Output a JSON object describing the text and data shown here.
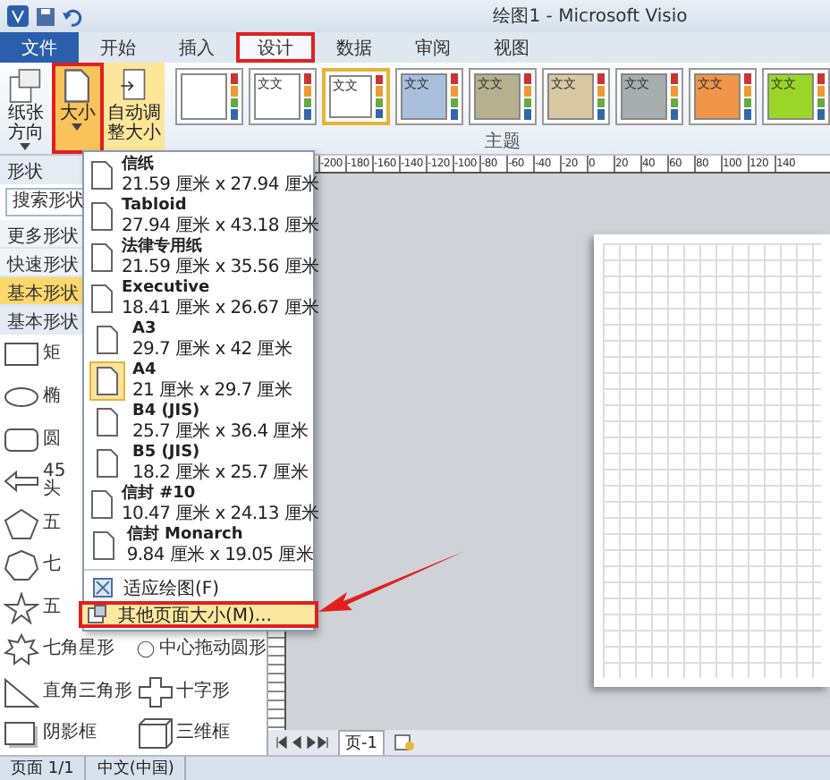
{
  "window": {
    "title": "绘图1 - Microsoft Visio"
  },
  "tabs": [
    {
      "label": "文件",
      "kind": "file",
      "selected": false,
      "annotated": false
    },
    {
      "label": "开始",
      "kind": "tab",
      "selected": false,
      "annotated": false
    },
    {
      "label": "插入",
      "kind": "tab",
      "selected": false,
      "annotated": false
    },
    {
      "label": "设计",
      "kind": "tab",
      "selected": true,
      "annotated": true
    },
    {
      "label": "数据",
      "kind": "tab",
      "selected": false,
      "annotated": false
    },
    {
      "label": "审阅",
      "kind": "tab",
      "selected": false,
      "annotated": false
    },
    {
      "label": "视图",
      "kind": "tab",
      "selected": false,
      "annotated": false
    }
  ],
  "page_setup": [
    {
      "label": "纸张方向",
      "kind": "orientation",
      "expanded": false,
      "highlighted": false,
      "annotated": false
    },
    {
      "label": "大小",
      "kind": "size",
      "expanded": true,
      "highlighted": false,
      "annotated": true
    },
    {
      "label": "自动调整大小",
      "kind": "autosize",
      "expanded": false,
      "highlighted": true,
      "annotated": false
    }
  ],
  "themes": {
    "label": "主题",
    "items": [
      {
        "color": "#ffffff",
        "selected": false
      },
      {
        "color": "#ffffff",
        "sample": "文文",
        "selected": false
      },
      {
        "color": "#ffffff",
        "sample": "文文",
        "selected": true
      },
      {
        "color": "#a9bfdc",
        "sample": "文文",
        "selected": false
      },
      {
        "color": "#b5b08e",
        "sample": "文文",
        "selected": false
      },
      {
        "color": "#d9c9a3",
        "sample": "文文",
        "selected": false
      },
      {
        "color": "#a8aeae",
        "sample": "文文",
        "selected": false
      },
      {
        "color": "#f0954a",
        "sample": "文文",
        "selected": false
      },
      {
        "color": "#9ad628",
        "sample": "文文",
        "selected": false
      }
    ]
  },
  "shapes_panel": {
    "title": "形状",
    "search": {
      "placeholder": "搜索形状"
    },
    "links": [
      {
        "label": "更多形状",
        "selected": false
      },
      {
        "label": "快速形状",
        "selected": false
      },
      {
        "label": "基本形状",
        "selected": true
      }
    ],
    "stencil_title": "基本形状",
    "shapes": [
      [
        {
          "kind": "rectangle",
          "label": "矩"
        }
      ],
      [
        {
          "kind": "ellipse",
          "label": "椭"
        }
      ],
      [
        {
          "kind": "rounded",
          "label": "圆"
        }
      ],
      [
        {
          "kind": "arrow",
          "label": "45 头"
        }
      ],
      [
        {
          "kind": "pentagon",
          "label": "五"
        }
      ],
      [
        {
          "kind": "heptagon",
          "label": "七"
        }
      ],
      [
        {
          "kind": "star5",
          "label": "五"
        }
      ],
      [
        {
          "kind": "star7",
          "label": "七角星形"
        },
        {
          "kind": "circle",
          "label": "中心拖动圆形"
        }
      ],
      [
        {
          "kind": "triangle",
          "label": "直角三角形"
        },
        {
          "kind": "cross",
          "label": "十字形"
        }
      ],
      [
        {
          "kind": "shadow",
          "label": "阴影框"
        },
        {
          "kind": "box3d",
          "label": "三维框"
        }
      ]
    ]
  },
  "ruler": {
    "labels": [
      "-200",
      "-180",
      "-160",
      "-140",
      "-120",
      "-100",
      "-80",
      "-60",
      "-40",
      "-20",
      "0",
      "20",
      "40",
      "60",
      "80",
      "100",
      "120",
      "140"
    ]
  },
  "size_menu": {
    "items": [
      {
        "name": "信纸",
        "size": "21.59 厘米 x 27.94 厘米",
        "selected": false
      },
      {
        "name": "Tabloid",
        "size": "27.94 厘米 x 43.18 厘米",
        "selected": false
      },
      {
        "name": "法律专用纸",
        "size": "21.59 厘米 x 35.56 厘米",
        "selected": false
      },
      {
        "name": "Executive",
        "size": "18.41 厘米 x 26.67 厘米",
        "selected": false
      },
      {
        "name": "A3",
        "size": "29.7 厘米 x 42 厘米",
        "selected": false
      },
      {
        "name": "A4",
        "size": "21 厘米 x 29.7 厘米",
        "selected": true
      },
      {
        "name": "B4 (JIS)",
        "size": "25.7 厘米 x 36.4 厘米",
        "selected": false
      },
      {
        "name": "B5 (JIS)",
        "size": "18.2 厘米 x 25.7 厘米",
        "selected": false
      },
      {
        "name": "信封 #10",
        "size": "10.47 厘米 x 24.13 厘米",
        "selected": false
      },
      {
        "name": "信封 Monarch",
        "size": "9.84 厘米 x 19.05 厘米",
        "selected": false
      }
    ],
    "commands": [
      {
        "label": "适应绘图(F)",
        "kind": "fit",
        "highlighted": false,
        "annotated": false
      },
      {
        "label": "其他页面大小(M)...",
        "kind": "custom",
        "highlighted": true,
        "annotated": true
      }
    ]
  },
  "page_tabs": [
    {
      "label": "页-1",
      "selected": true
    }
  ],
  "status_bar": [
    "页面 1/1",
    "中文(中国)"
  ]
}
